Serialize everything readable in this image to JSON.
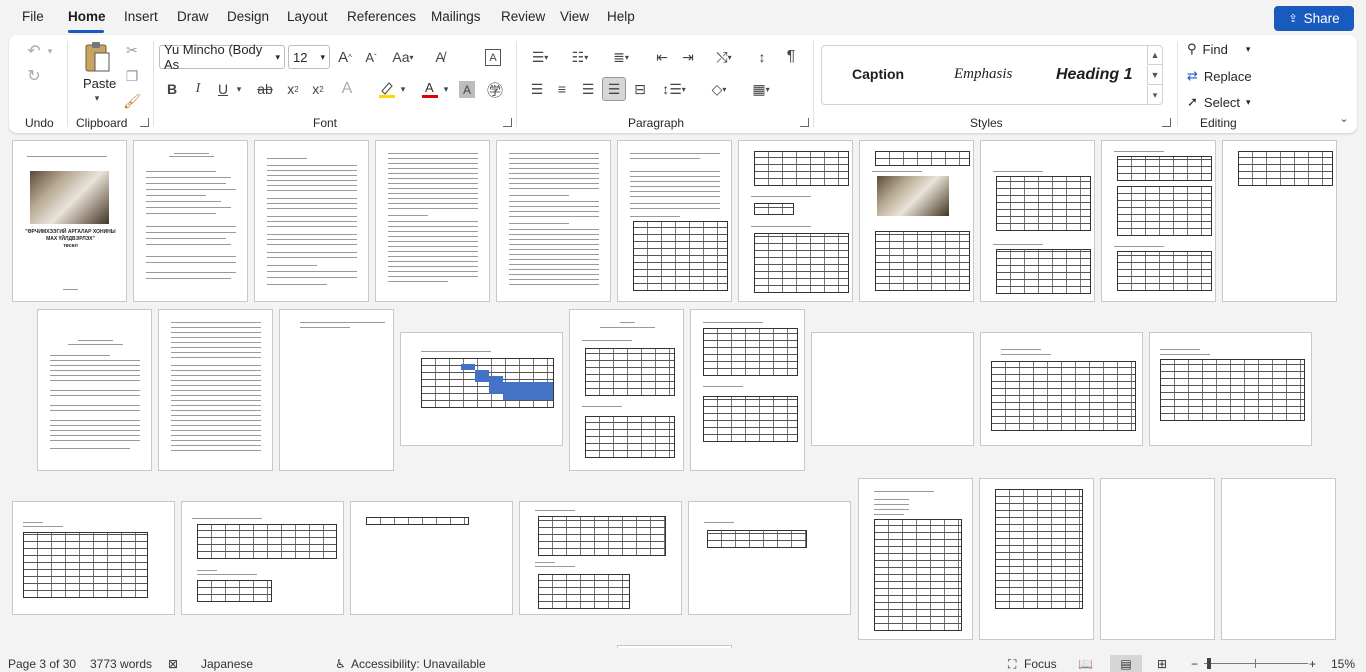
{
  "menu": {
    "tabs": [
      "File",
      "Home",
      "Insert",
      "Draw",
      "Design",
      "Layout",
      "References",
      "Mailings",
      "Review",
      "View",
      "Help"
    ],
    "share_label": "Share"
  },
  "ribbon": {
    "groups": {
      "undo": "Undo",
      "clipboard": "Clipboard",
      "font": "Font",
      "paragraph": "Paragraph",
      "styles": "Styles",
      "editing": "Editing"
    },
    "paste_label": "Paste",
    "font_name": "Yu Mincho (Body As",
    "font_size": "12",
    "styles": [
      "Caption",
      "Emphasis",
      "Heading 1"
    ],
    "editing": {
      "find": "Find",
      "replace": "Replace",
      "select": "Select"
    }
  },
  "document": {
    "cover_title_line1": "\"ӨРЧИМХЭЭГИЙ АРГАЛАР ХОНИНЫ",
    "cover_title_line2": "МАХ ҮЙЛДВЭРЛЭХ\"",
    "cover_title_line3": "төсөл"
  },
  "status": {
    "page": "Page 3 of 30",
    "words": "3773 words",
    "language": "Japanese",
    "accessibility": "Accessibility: Unavailable",
    "focus": "Focus",
    "zoom": "15%"
  },
  "colors": {
    "accent": "#185abd",
    "highlight_yellow": "#ffd800",
    "font_color_red": "#e00000",
    "table_fill_blue": "#4472c4"
  }
}
